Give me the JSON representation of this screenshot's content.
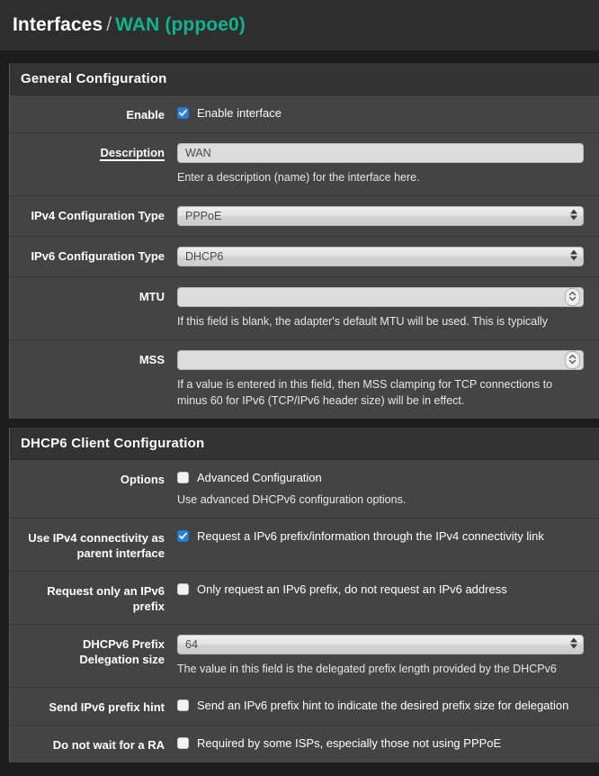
{
  "breadcrumb": {
    "root": "Interfaces",
    "separator": "/",
    "leaf": "WAN (pppoe0)"
  },
  "colors": {
    "accent_teal": "#12b28c",
    "checkbox_checked": "#2e7fd8",
    "page_bg": "#1d1d1d",
    "panel_bg": "#444444",
    "panel_head_bg": "#333333",
    "header_bg": "#2e2e2e"
  },
  "panels": [
    {
      "title": "General Configuration",
      "rows": [
        {
          "label": "Enable",
          "label_tooltip": false,
          "checkbox_label": "Enable interface",
          "checked": true
        },
        {
          "label": "Description",
          "label_tooltip": true,
          "value": "WAN",
          "placeholder": "",
          "help": "Enter a description (name) for the interface here."
        },
        {
          "label": "IPv4 Configuration Type",
          "value": "PPPoE"
        },
        {
          "label": "IPv6 Configuration Type",
          "value": "DHCP6"
        },
        {
          "label": "MTU",
          "value": "",
          "help": "If this field is blank, the adapter's default MTU will be used. This is typically"
        },
        {
          "label": "MSS",
          "value": "",
          "help_line1": "If a value is entered in this field, then MSS clamping for TCP connections to",
          "help_line2": "minus 60 for IPv6 (TCP/IPv6 header size) will be in effect."
        }
      ]
    },
    {
      "title": "DHCP6 Client Configuration",
      "rows": [
        {
          "label": "Options",
          "checkbox_label": "Advanced Configuration",
          "checked": false,
          "help": "Use advanced DHCPv6 configuration options."
        },
        {
          "label_line1": "Use IPv4 connectivity as",
          "label_line2": "parent interface",
          "checkbox_label": "Request a IPv6 prefix/information through the IPv4 connectivity link",
          "checked": true
        },
        {
          "label_line1": "Request only an IPv6",
          "label_line2": "prefix",
          "checkbox_label": "Only request an IPv6 prefix, do not request an IPv6 address",
          "checked": false
        },
        {
          "label_line1": "DHCPv6 Prefix",
          "label_line2": "Delegation size",
          "value": "64",
          "help": "The value in this field is the delegated prefix length provided by the DHCPv6"
        },
        {
          "label": "Send IPv6 prefix hint",
          "checkbox_label": "Send an IPv6 prefix hint to indicate the desired prefix size for delegation",
          "checked": false
        },
        {
          "label": "Do not wait for a RA",
          "checkbox_label": "Required by some ISPs, especially those not using PPPoE",
          "checked": false
        }
      ]
    }
  ]
}
